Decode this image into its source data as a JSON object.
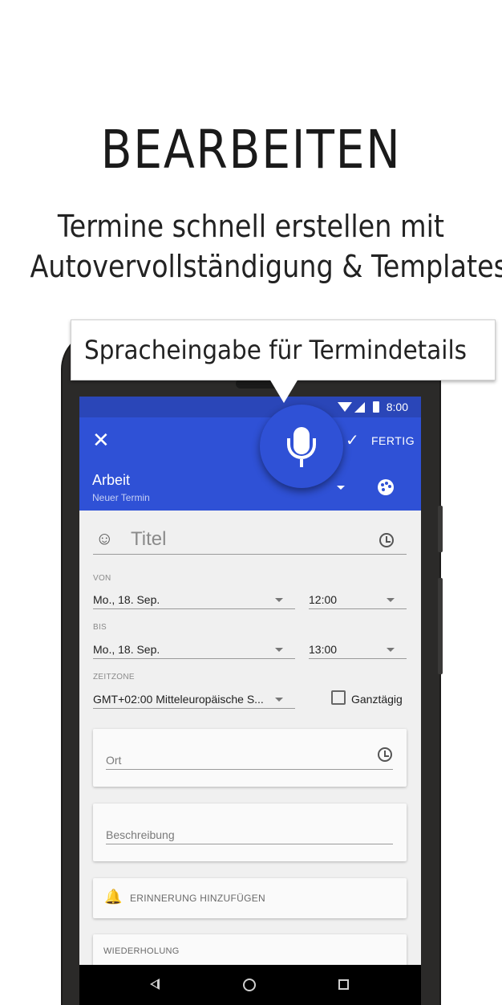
{
  "promo": {
    "headline": "BEARBEITEN",
    "subline_1": "Termine schnell erstellen mit",
    "subline_2": "Autovervollständigung & Templates",
    "tooltip": "Spracheingabe für Termindetails"
  },
  "status_bar": {
    "time": "8:00"
  },
  "app_bar": {
    "done_label": "FERTIG",
    "calendar_name": "Arbeit",
    "calendar_subtitle": "Neuer Termin"
  },
  "form": {
    "title_placeholder": "Titel",
    "from_label": "VON",
    "from_date": "Mo., 18. Sep.",
    "from_time": "12:00",
    "to_label": "BIS",
    "to_date": "Mo., 18. Sep.",
    "to_time": "13:00",
    "timezone_label": "ZEITZONE",
    "timezone_value": "GMT+02:00 Mitteleuropäische S...",
    "all_day_label": "Ganztägig",
    "all_day_checked": false,
    "location_placeholder": "Ort",
    "description_placeholder": "Beschreibung",
    "add_reminder_label": "ERINNERUNG HINZUFÜGEN",
    "repeat_label": "WIEDERHOLUNG"
  },
  "colors": {
    "app_bar": "#2f51d6",
    "status_bar": "#2a46b8",
    "screen_bg": "#f0f0f0"
  },
  "icons": [
    "close-icon",
    "check-icon",
    "mic-icon",
    "palette-icon",
    "smiley-icon",
    "history-icon",
    "bell-add-icon",
    "back-icon",
    "home-icon",
    "recents-icon"
  ]
}
